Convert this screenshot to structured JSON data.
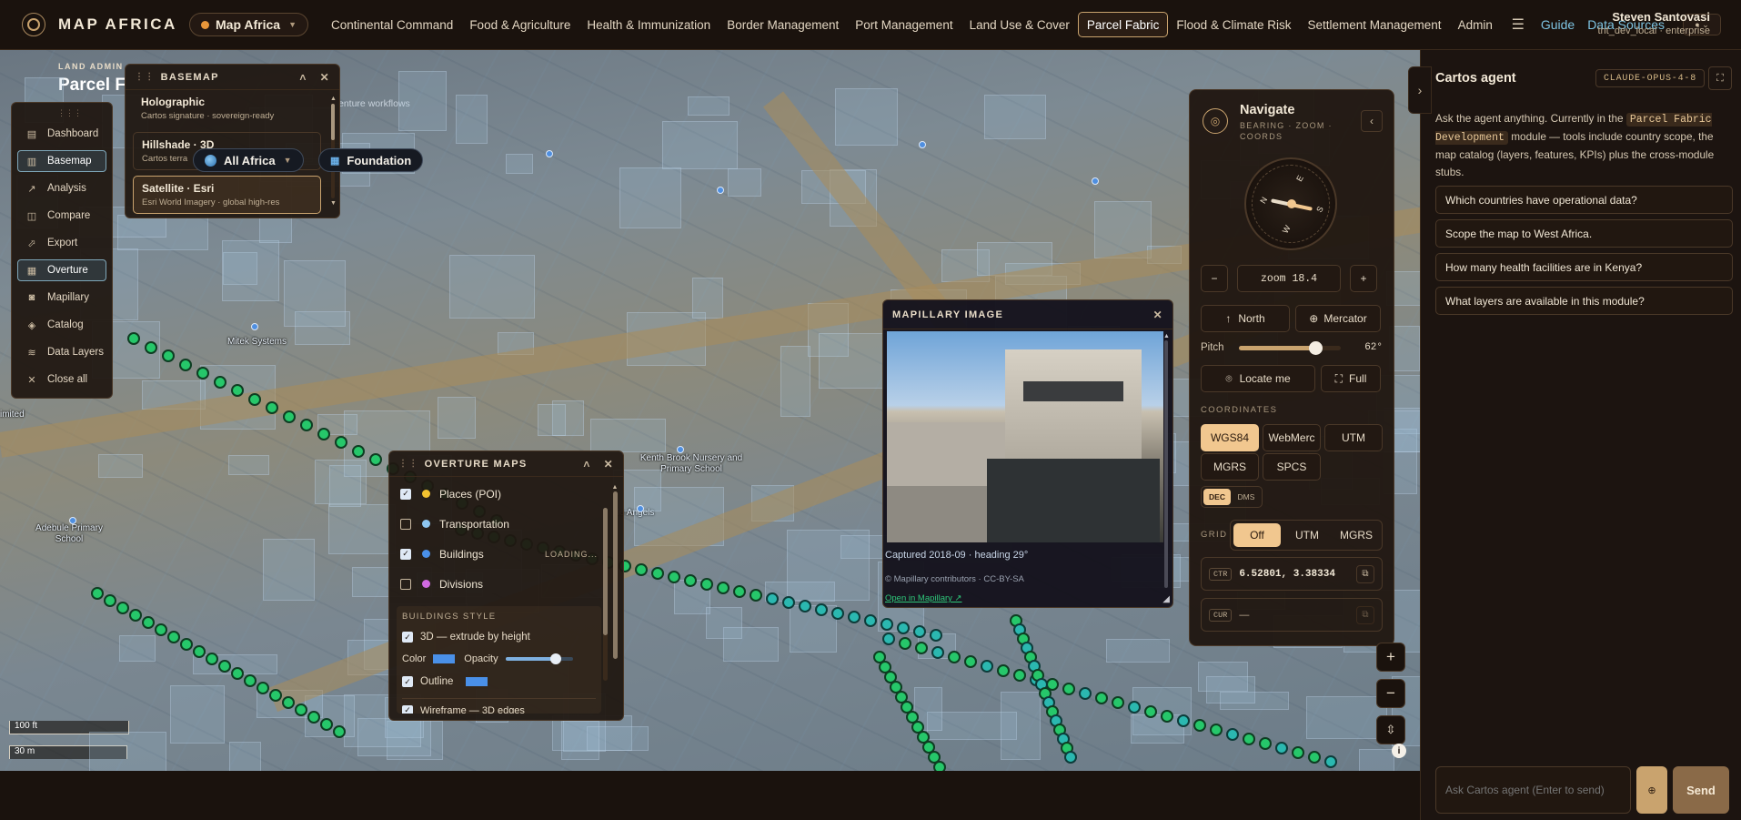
{
  "header": {
    "brand": "MAP AFRICA",
    "app_selector": "Map Africa",
    "tabs": [
      "Continental Command",
      "Food & Agriculture",
      "Health & Immunization",
      "Border Management",
      "Port Management",
      "Land Use & Cover",
      "Parcel Fabric",
      "Flood & Climate Risk",
      "Settlement Management",
      "Admin"
    ],
    "active_tab": "Parcel Fabric",
    "guide": "Guide",
    "data_sources": "Data Sources",
    "user_name": "Steven Santovasi",
    "user_role": "tnt_dev_local · enterprise"
  },
  "page_heading": {
    "eyebrow": "LAND ADMIN",
    "title": "Parcel F",
    "note": "enture workflows"
  },
  "basemap": {
    "title": "BASEMAP",
    "items": [
      {
        "title": "Holographic",
        "sub": "Cartos signature · sovereign-ready"
      },
      {
        "title": "Hillshade · 3D",
        "sub": "Cartos terra"
      },
      {
        "title": "Satellite · Esri",
        "sub": "Esri World Imagery · global high-res"
      }
    ]
  },
  "scope": {
    "region": "All Africa",
    "layer": "Foundation"
  },
  "sidebar": {
    "items": [
      {
        "label": "Dashboard",
        "icon": "dashboard-icon"
      },
      {
        "label": "Basemap",
        "icon": "map-icon"
      },
      {
        "label": "Analysis",
        "icon": "chart-line-icon"
      },
      {
        "label": "Compare",
        "icon": "compare-icon"
      },
      {
        "label": "Export",
        "icon": "export-icon"
      },
      {
        "label": "Overture",
        "icon": "grid-icon"
      },
      {
        "label": "Mapillary",
        "icon": "camera-icon"
      },
      {
        "label": "Catalog",
        "icon": "layers-icon"
      },
      {
        "label": "Data Layers",
        "icon": "stack-icon"
      },
      {
        "label": "Close all",
        "icon": "close-icon"
      }
    ]
  },
  "overture": {
    "title": "OVERTURE MAPS",
    "layers": [
      {
        "label": "Places (POI)",
        "checked": true,
        "color": "#f2c230",
        "status": ""
      },
      {
        "label": "Transportation",
        "checked": false,
        "color": "#8ec6f0",
        "status": ""
      },
      {
        "label": "Buildings",
        "checked": true,
        "color": "#4a90e8",
        "status": "LOADING..."
      },
      {
        "label": "Divisions",
        "checked": false,
        "color": "#d06ae0",
        "status": ""
      }
    ],
    "style_title": "BUILDINGS STYLE",
    "extrude": "3D — extrude by height",
    "color_label": "Color",
    "opacity_label": "Opacity",
    "opacity": 0.75,
    "outline": "Outline",
    "wireframe": "Wireframe — 3D edges"
  },
  "mapillary": {
    "title": "MAPILLARY IMAGE",
    "caption": "Captured 2018-09 · heading 29°",
    "credit": "© Mapillary contributors · CC-BY-SA",
    "link": "Open in Mapillary ↗"
  },
  "navigate": {
    "title": "Navigate",
    "subtitle": "BEARING · ZOOM · COORDS",
    "zoom": "zoom 18.4",
    "north": "North",
    "projection": "Mercator",
    "pitch_label": "Pitch",
    "pitch": "62°",
    "pitch_fraction": 0.75,
    "locate": "Locate me",
    "full": "Full",
    "coord_label": "COORDINATES",
    "coord_systems": [
      "WGS84",
      "WebMerc",
      "UTM",
      "MGRS",
      "SPCS"
    ],
    "coord_active": "WGS84",
    "fmt": [
      "DEC",
      "DMS"
    ],
    "fmt_active": "DEC",
    "grid_label": "GRID",
    "grid": [
      "Off",
      "UTM",
      "MGRS"
    ],
    "grid_active": "Off",
    "ctr_tag": "CTR",
    "ctr": "6.52801, 3.38334",
    "cur_tag": "CUR",
    "cur": "—"
  },
  "scale": {
    "imperial": "100 ft",
    "metric": "30 m"
  },
  "map_labels": [
    "Adebule Primary School",
    "Mitek Systems",
    "Kenth Brook Nursery and Primary School",
    "tle Angels",
    "imited"
  ],
  "agent": {
    "title": "Cartos agent",
    "model": "CLAUDE-OPUS-4-8",
    "intro_a": "Ask the agent anything. Currently in the",
    "module": "Parcel Fabric Development",
    "intro_b": "module — tools include country scope, the map catalog (layers, features, KPIs) plus the cross-module stubs.",
    "questions": [
      "Which countries have operational data?",
      "Scope the map to West Africa.",
      "How many health facilities are in Kenya?",
      "What layers are available in this module?"
    ],
    "placeholder": "Ask Cartos agent (Enter to send)",
    "send": "Send"
  }
}
